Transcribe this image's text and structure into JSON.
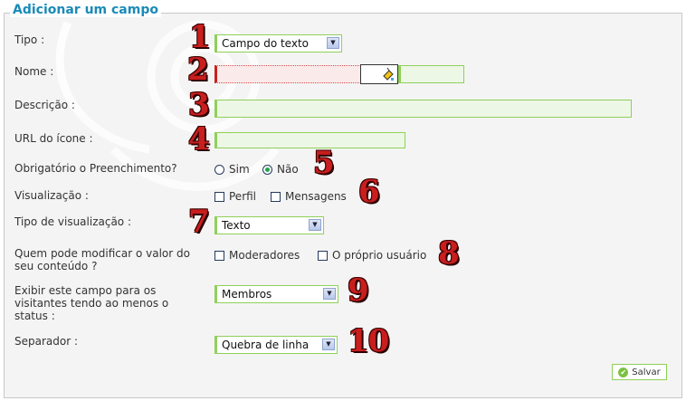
{
  "title": "Adicionar um campo",
  "fields": {
    "tipo": {
      "label": "Tipo :",
      "value": "Campo do texto"
    },
    "nome": {
      "label": "Nome :"
    },
    "descricao": {
      "label": "Descrição :"
    },
    "url_icone": {
      "label": "URL do ícone :"
    },
    "obrigatorio": {
      "label": "Obrigatório o Preenchimento?",
      "options": [
        "Sim",
        "Não"
      ],
      "selected": "Não"
    },
    "visualizacao": {
      "label": "Visualização :",
      "options": [
        "Perfil",
        "Mensagens"
      ]
    },
    "tipo_visualizacao": {
      "label": "Tipo de visualização :",
      "value": "Texto"
    },
    "modificar": {
      "label_line1": "Quem pode modificar o valor do",
      "label_line2": "seu conteúdo ?",
      "options": [
        "Moderadores",
        "O próprio usuário"
      ]
    },
    "exibir": {
      "label_line1": "Exibir este campo para os",
      "label_line2": "visitantes tendo ao menos o",
      "label_line3": "status :",
      "value": "Membros"
    },
    "separador": {
      "label": "Separador :",
      "value": "Quebra de linha"
    }
  },
  "numbers": [
    "1",
    "2",
    "3",
    "4",
    "5",
    "6",
    "7",
    "8",
    "9",
    "10"
  ],
  "save_label": "Salvar",
  "colors": {
    "accent_green": "#8fd05a",
    "title_blue": "#1b8ab8",
    "number_red": "#c81e1e"
  }
}
